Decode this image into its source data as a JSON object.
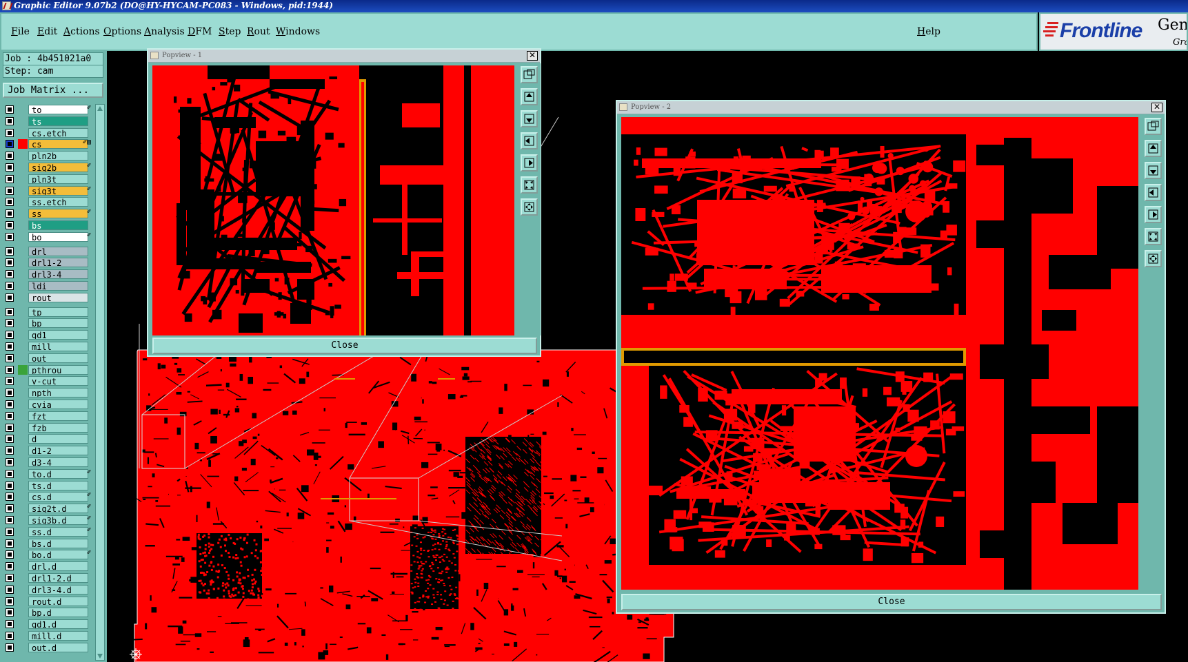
{
  "window": {
    "title": "Graphic Editor 9.07b2 (DO@HY-HYCAM-PC083 - Windows, pid:1944)"
  },
  "menubar": {
    "items": [
      "File",
      "Edit",
      "Actions",
      "Options",
      "Analysis",
      "DFM",
      "Step",
      "Rout",
      "Windows"
    ],
    "help": "Help"
  },
  "logo": {
    "brand": "Frontline",
    "product": "Genc",
    "sub": "Gra"
  },
  "job": {
    "job_label": "Job : 4b451021a0",
    "step_label": "Step: cam",
    "matrix_button": "Job Matrix ..."
  },
  "layers": [
    {
      "name": "to",
      "style": "white",
      "swatch": "#6fb7ac",
      "edit": "✐"
    },
    {
      "name": "ts",
      "style": "green",
      "swatch": "#6fb7ac",
      "edit": ""
    },
    {
      "name": "cs.etch",
      "style": "normal",
      "swatch": "#6fb7ac",
      "edit": ""
    },
    {
      "name": "cs",
      "style": "yellow",
      "swatch": "#ff0000",
      "edit": "✐▤",
      "active": true
    },
    {
      "name": "pln2b",
      "style": "normal",
      "swatch": "#6fb7ac",
      "edit": ""
    },
    {
      "name": "sig2b",
      "style": "yellow",
      "swatch": "#6fb7ac",
      "edit": "✐"
    },
    {
      "name": "pln3t",
      "style": "normal",
      "swatch": "#6fb7ac",
      "edit": ""
    },
    {
      "name": "sig3t",
      "style": "yellow",
      "swatch": "#6fb7ac",
      "edit": "✐"
    },
    {
      "name": "ss.etch",
      "style": "normal",
      "swatch": "#6fb7ac",
      "edit": ""
    },
    {
      "name": "ss",
      "style": "yellow",
      "swatch": "#6fb7ac",
      "edit": "✐"
    },
    {
      "name": "bs",
      "style": "green",
      "swatch": "#6fb7ac",
      "edit": ""
    },
    {
      "name": "bo",
      "style": "white",
      "swatch": "#6fb7ac",
      "edit": "✐"
    },
    {
      "name": "drl",
      "style": "drill",
      "swatch": "#6fb7ac",
      "edit": ""
    },
    {
      "name": "drl1-2",
      "style": "drill",
      "swatch": "#6fb7ac",
      "edit": ""
    },
    {
      "name": "drl3-4",
      "style": "drill",
      "swatch": "#6fb7ac",
      "edit": ""
    },
    {
      "name": "ldi",
      "style": "drill",
      "swatch": "#6fb7ac",
      "edit": ""
    },
    {
      "name": "rout",
      "style": "light",
      "swatch": "#6fb7ac",
      "edit": ""
    },
    {
      "name": "tp",
      "style": "normal",
      "swatch": "#6fb7ac",
      "edit": ""
    },
    {
      "name": "bp",
      "style": "normal",
      "swatch": "#6fb7ac",
      "edit": ""
    },
    {
      "name": "gd1",
      "style": "normal",
      "swatch": "#6fb7ac",
      "edit": ""
    },
    {
      "name": "mill",
      "style": "normal",
      "swatch": "#6fb7ac",
      "edit": ""
    },
    {
      "name": "out",
      "style": "normal",
      "swatch": "#6fb7ac",
      "edit": ""
    },
    {
      "name": "pthrou",
      "style": "normal",
      "swatch": "#3aa33a",
      "edit": ""
    },
    {
      "name": "v-cut",
      "style": "normal",
      "swatch": "#6fb7ac",
      "edit": ""
    },
    {
      "name": "npth",
      "style": "normal",
      "swatch": "#6fb7ac",
      "edit": ""
    },
    {
      "name": "cvia",
      "style": "normal",
      "swatch": "#6fb7ac",
      "edit": ""
    },
    {
      "name": "fzt",
      "style": "normal",
      "swatch": "#6fb7ac",
      "edit": ""
    },
    {
      "name": "fzb",
      "style": "normal",
      "swatch": "#6fb7ac",
      "edit": ""
    },
    {
      "name": "d",
      "style": "normal",
      "swatch": "#6fb7ac",
      "edit": ""
    },
    {
      "name": "d1-2",
      "style": "normal",
      "swatch": "#6fb7ac",
      "edit": ""
    },
    {
      "name": "d3-4",
      "style": "normal",
      "swatch": "#6fb7ac",
      "edit": ""
    },
    {
      "name": "to.d",
      "style": "normal",
      "swatch": "#6fb7ac",
      "edit": "✐"
    },
    {
      "name": "ts.d",
      "style": "normal",
      "swatch": "#6fb7ac",
      "edit": ""
    },
    {
      "name": "cs.d",
      "style": "normal",
      "swatch": "#6fb7ac",
      "edit": "✐"
    },
    {
      "name": "sig2t.d",
      "style": "normal",
      "swatch": "#6fb7ac",
      "edit": "✐"
    },
    {
      "name": "sig3b.d",
      "style": "normal",
      "swatch": "#6fb7ac",
      "edit": "✐"
    },
    {
      "name": "ss.d",
      "style": "normal",
      "swatch": "#6fb7ac",
      "edit": "✐"
    },
    {
      "name": "bs.d",
      "style": "normal",
      "swatch": "#6fb7ac",
      "edit": ""
    },
    {
      "name": "bo.d",
      "style": "normal",
      "swatch": "#6fb7ac",
      "edit": "✐"
    },
    {
      "name": "drl.d",
      "style": "normal",
      "swatch": "#6fb7ac",
      "edit": ""
    },
    {
      "name": "drl1-2.d",
      "style": "normal",
      "swatch": "#6fb7ac",
      "edit": ""
    },
    {
      "name": "drl3-4.d",
      "style": "normal",
      "swatch": "#6fb7ac",
      "edit": ""
    },
    {
      "name": "rout.d",
      "style": "normal",
      "swatch": "#6fb7ac",
      "edit": ""
    },
    {
      "name": "bp.d",
      "style": "normal",
      "swatch": "#6fb7ac",
      "edit": ""
    },
    {
      "name": "gd1.d",
      "style": "normal",
      "swatch": "#6fb7ac",
      "edit": ""
    },
    {
      "name": "mill.d",
      "style": "normal",
      "swatch": "#6fb7ac",
      "edit": ""
    },
    {
      "name": "out.d",
      "style": "normal",
      "swatch": "#6fb7ac",
      "edit": ""
    }
  ],
  "popup1": {
    "title": "Popview - 1",
    "close_label": "Close"
  },
  "popup2": {
    "title": "Popview - 2",
    "close_label": "Close"
  },
  "tool_buttons": [
    "zoom-window-icon",
    "pan-up-icon",
    "pan-down-icon",
    "pan-left-icon",
    "pan-right-icon",
    "zoom-fit-icon",
    "zoom-home-icon"
  ],
  "colors": {
    "copper": "#ff0000",
    "background": "#000000",
    "panel": "#6fb7ac",
    "panel_light": "#9cdcd3",
    "highlight": "#e09a00"
  }
}
